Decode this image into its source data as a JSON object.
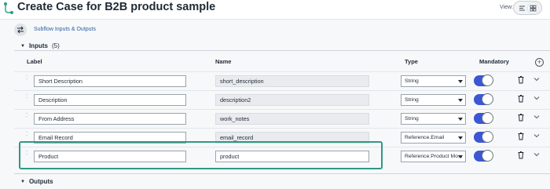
{
  "header": {
    "title": "Create Case for B2B product sample",
    "view_label": "View:"
  },
  "subflow": {
    "link_label": "Subflow Inputs & Outputs"
  },
  "inputs": {
    "label": "Inputs",
    "count": "(5)",
    "columns": {
      "label": "Label",
      "name": "Name",
      "type": "Type",
      "mandatory": "Mandatory"
    },
    "rows": [
      {
        "label": "Short Description",
        "name": "short_description",
        "type": "String",
        "mandatory": true
      },
      {
        "label": "Description",
        "name": "description2",
        "type": "String",
        "mandatory": true
      },
      {
        "label": "From Address",
        "name": "work_notes",
        "type": "String",
        "mandatory": true
      },
      {
        "label": "Email Record",
        "name": "email_record",
        "type": "Reference.Email",
        "mandatory": true
      },
      {
        "label": "Product",
        "name": "product",
        "type": "Reference.Product Mo...",
        "mandatory": true
      }
    ]
  },
  "outputs": {
    "label": "Outputs"
  },
  "colors": {
    "toggle_on": "#3b57d6",
    "highlight": "#2e9a82",
    "link": "#2d5fa8"
  },
  "icons": {
    "logo": "servicenow-flow-logo",
    "subflow": "swap-arrows-icon",
    "add": "plus-circle-icon",
    "delete": "trash-icon",
    "expand": "chevron-down-icon"
  }
}
